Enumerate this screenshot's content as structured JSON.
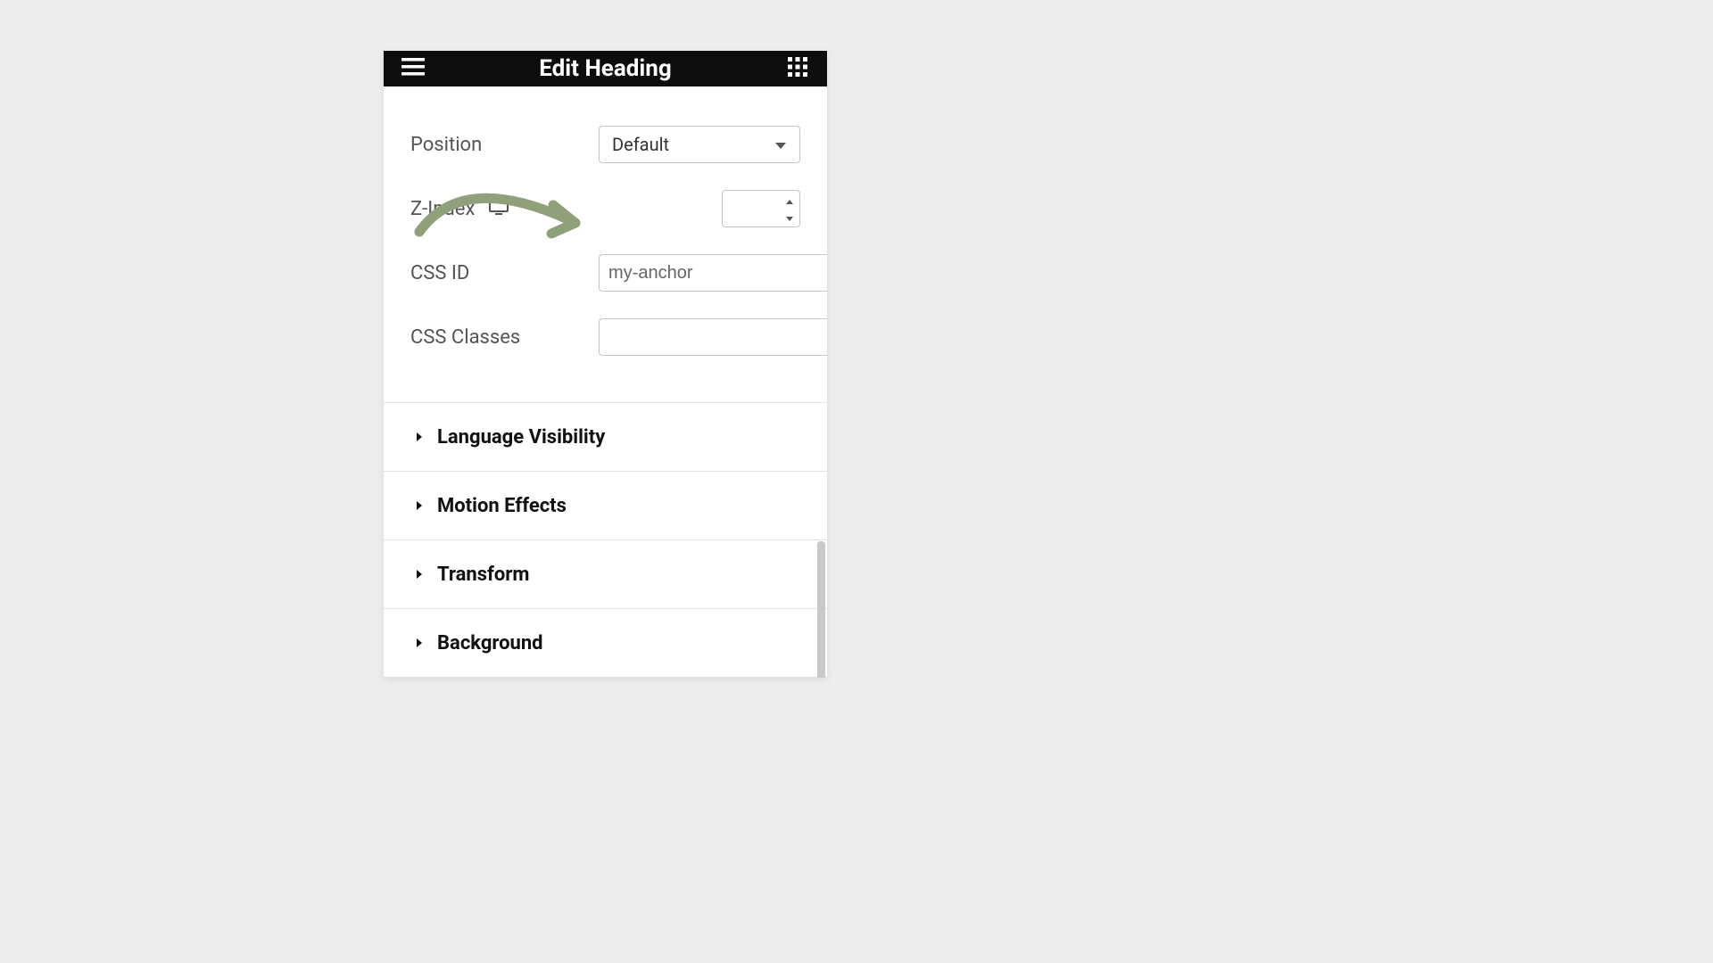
{
  "header": {
    "title": "Edit Heading"
  },
  "form": {
    "position": {
      "label": "Position",
      "value": "Default"
    },
    "zindex": {
      "label": "Z-Index",
      "value": ""
    },
    "cssid": {
      "label": "CSS ID",
      "value": "my-anchor"
    },
    "cssclasses": {
      "label": "CSS Classes",
      "value": ""
    }
  },
  "sections": [
    {
      "title": "Language Visibility"
    },
    {
      "title": "Motion Effects"
    },
    {
      "title": "Transform"
    },
    {
      "title": "Background"
    }
  ]
}
